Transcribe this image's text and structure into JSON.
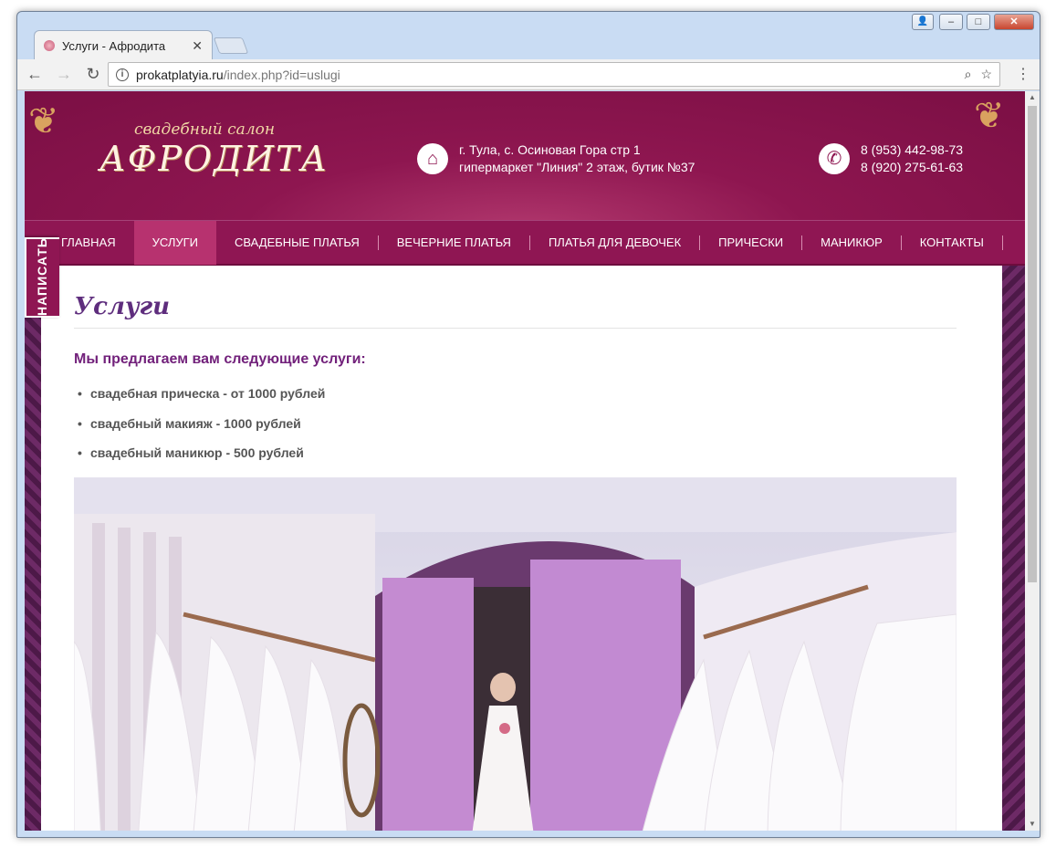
{
  "browser": {
    "tab_title": "Услуги - Афродита",
    "url_host": "prokatplatyia.ru",
    "url_path": "/index.php?id=uslugi"
  },
  "header": {
    "logo_small": "свадебный салон",
    "logo_big": "АФРОДИТА",
    "address_line1": "г. Тула, с. Осиновая Гора стр 1",
    "address_line2": "гипермаркет \"Линия\" 2 этаж, бутик №37",
    "phone1": "8 (953) 442-98-73",
    "phone2": "8 (920) 275-61-63"
  },
  "nav": {
    "items": [
      {
        "label": "ГЛАВНАЯ"
      },
      {
        "label": "УСЛУГИ"
      },
      {
        "label": "СВАДЕБНЫЕ ПЛАТЬЯ"
      },
      {
        "label": "ВЕЧЕРНИЕ ПЛАТЬЯ"
      },
      {
        "label": "ПЛАТЬЯ ДЛЯ ДЕВОЧЕК"
      },
      {
        "label": "ПРИЧЕСКИ"
      },
      {
        "label": "МАНИКЮР"
      },
      {
        "label": "КОНТАКТЫ"
      }
    ],
    "active": "УСЛУГИ"
  },
  "write_button": "НАПИСАТЬ",
  "main": {
    "title": "Услуги",
    "intro": "Мы предлагаем вам следующие услуги:",
    "services": [
      "свадебная прическа - от 1000 рублей",
      "свадебный макияж - 1000 рублей",
      "свадебный маникюр - 500 рублей"
    ]
  },
  "colors": {
    "brand": "#8f1653",
    "active_nav": "#b7326f",
    "title": "#5e2d7d"
  }
}
